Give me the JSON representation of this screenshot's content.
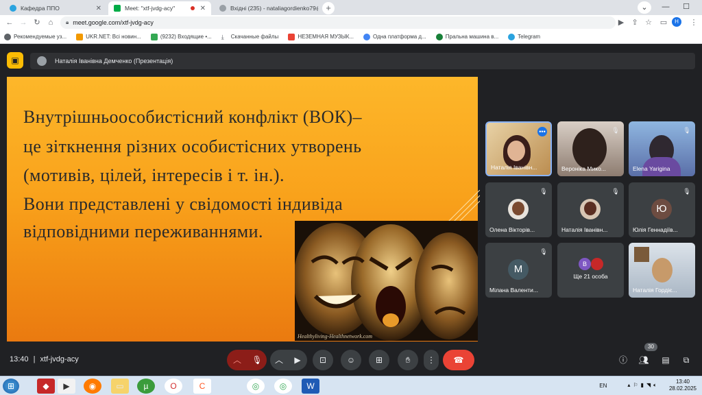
{
  "browser": {
    "tabs": [
      {
        "title": "Кафедра ППО",
        "icon": "telegram-icon",
        "color": "#2aa3df"
      },
      {
        "title": "Meet: \"xtf-jvdg-acy\"",
        "icon": "google-meet-icon",
        "color": "#00ac47"
      },
      {
        "title": "Вхідні (235) - nataliagordienko79@",
        "icon": "gmail-icon",
        "color": "#9aa0a6"
      }
    ],
    "url": "meet.google.com/xtf-jvdg-acy",
    "profile_initial": "H",
    "bookmarks": [
      {
        "label": "Рекомендуемые уз...",
        "color": "#5f6368"
      },
      {
        "label": "UKR.NET: Всі новин...",
        "color": "#f29900"
      },
      {
        "label": "(9232) Входящие •...",
        "color": "#34a853"
      },
      {
        "label": "Скачанные файлы",
        "color": "#5f6368"
      },
      {
        "label": "НЕЗЕМНАЯ МУЗЫК...",
        "color": "#ea4335"
      },
      {
        "label": "Одна платформа д...",
        "color": "#4285f4"
      },
      {
        "label": "Пральна машина в...",
        "color": "#188038"
      },
      {
        "label": "Telegram",
        "color": "#2aa3df"
      }
    ]
  },
  "meet": {
    "presenter_label": "Наталія Іванівна Демченко (Презентація)",
    "slide": {
      "lines": [
        "Внутрішньоособистісний  конфлікт  (ВОК)–",
        "це  зіткнення  різних  особистісних  утворень",
        "(мотивів,  цілей,  інтересів  і  т.  ін.).",
        " Вони представлені у свідомості індивіда",
        "відповідними переживаннями."
      ],
      "image_caption": "Healthyliving-Healthnetwork.com"
    },
    "participants": [
      {
        "name": "Наталія Іванівн...",
        "avatar": "",
        "muted": false
      },
      {
        "name": "Вероніка Мико...",
        "avatar": "",
        "muted": true
      },
      {
        "name": "Elena Yarigina",
        "avatar": "",
        "muted": true
      },
      {
        "name": "Олена Вікторів...",
        "avatar": "",
        "muted": true
      },
      {
        "name": "Наталія Іванівн...",
        "avatar": "",
        "muted": true
      },
      {
        "name": "Юлія Геннадіїв...",
        "avatar": "Ю",
        "muted": true
      },
      {
        "name": "Мілана Валенти...",
        "avatar": "M",
        "muted": true
      },
      {
        "name": "Ще 21 особа",
        "avatar": "В",
        "muted": false
      },
      {
        "name": "Наталія Гордіє...",
        "avatar": "",
        "muted": false
      }
    ],
    "time": "13:40",
    "meeting_code": "xtf-jvdg-acy",
    "people_count": "30"
  },
  "taskbar": {
    "language": "EN",
    "time": "13:40",
    "date": "28.02.2025"
  }
}
